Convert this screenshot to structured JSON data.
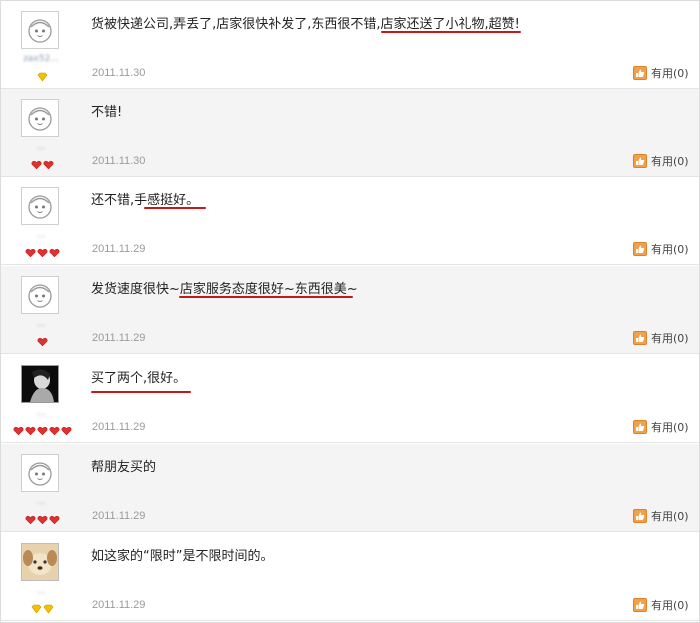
{
  "colors": {
    "underline": "#c21a1a",
    "useful_icon": "#f2a04a",
    "date": "#9a9a9a"
  },
  "reviews": [
    {
      "avatar_icon": "default-avatar-icon",
      "username": "zax52...",
      "badge_icon": "gold-diamond-icon",
      "badge_count": 1,
      "comment": "货被快递公司,弄丢了,店家很快补发了,东西很不错,店家还送了小礼物,超赞!",
      "date": "2011.11.30",
      "useful_label": "有用(0)"
    },
    {
      "avatar_icon": "default-avatar-icon",
      "username": "...",
      "badge_icon": "red-heart-icon",
      "badge_count": 2,
      "comment": "不错!",
      "date": "2011.11.30",
      "useful_label": "有用(0)"
    },
    {
      "avatar_icon": "default-avatar-icon",
      "username": "...",
      "badge_icon": "red-heart-icon",
      "badge_count": 3,
      "comment": "还不错,手感挺好。",
      "date": "2011.11.29",
      "useful_label": "有用(0)"
    },
    {
      "avatar_icon": "default-avatar-icon",
      "username": "...",
      "badge_icon": "red-heart-icon",
      "badge_count": 1,
      "comment": "发货速度很快~店家服务态度很好~东西很美~",
      "date": "2011.11.29",
      "useful_label": "有用(0)"
    },
    {
      "avatar_icon": "photo-avatar-icon",
      "username": "...",
      "badge_icon": "red-heart-icon",
      "badge_count": 5,
      "comment": "买了两个,很好。",
      "date": "2011.11.29",
      "useful_label": "有用(0)"
    },
    {
      "avatar_icon": "default-avatar-icon",
      "username": "...",
      "badge_icon": "red-heart-icon",
      "badge_count": 3,
      "comment": "帮朋友买的",
      "date": "2011.11.29",
      "useful_label": "有用(0)"
    },
    {
      "avatar_icon": "puppy-avatar-icon",
      "username": "...",
      "badge_icon": "gold-diamond-icon",
      "badge_count": 2,
      "comment": "如这家的“限时”是不限时间的。",
      "date": "2011.11.29",
      "useful_label": "有用(0)"
    }
  ]
}
